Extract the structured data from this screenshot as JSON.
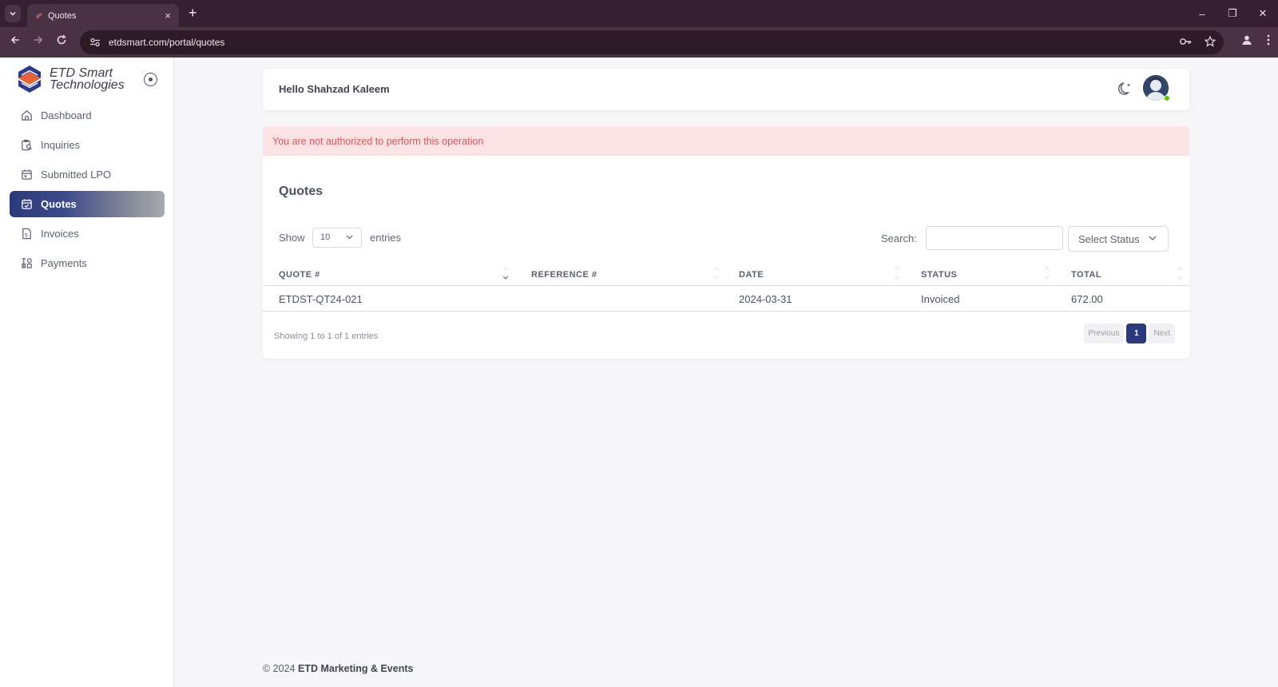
{
  "browser": {
    "tab_title": "Quotes",
    "tab_close": "×",
    "new_tab": "+",
    "url": "etdsmart.com/portal/quotes",
    "window_controls": [
      "–",
      "❐",
      "✕"
    ]
  },
  "brand": {
    "line1": "ETD Smart",
    "line2": "Technologies"
  },
  "sidebar": {
    "items": [
      {
        "label": "Dashboard",
        "icon": "home-icon",
        "active": false
      },
      {
        "label": "Inquiries",
        "icon": "inquiry-icon",
        "active": false
      },
      {
        "label": "Submitted LPO",
        "icon": "calendar-icon",
        "active": false
      },
      {
        "label": "Quotes",
        "icon": "calendar-check-icon",
        "active": true
      },
      {
        "label": "Invoices",
        "icon": "invoice-icon",
        "active": false
      },
      {
        "label": "Payments",
        "icon": "payments-icon",
        "active": false
      }
    ]
  },
  "header": {
    "greeting": "Hello Shahzad Kaleem"
  },
  "alert": {
    "message": "You are not authorized to perform this operation"
  },
  "quotes": {
    "title": "Quotes",
    "show_label": "Show",
    "page_length": "10",
    "entries_label": "entries",
    "search_label": "Search:",
    "search_value": "",
    "status_filter": "Select Status",
    "columns": [
      "QUOTE #",
      "REFERENCE #",
      "DATE",
      "STATUS",
      "TOTAL"
    ],
    "rows": [
      {
        "quote": "ETDST-QT24-021",
        "reference": "",
        "date": "2024-03-31",
        "status": "Invoiced",
        "total": "672.00"
      }
    ],
    "info": "Showing 1 to 1 of 1 entries",
    "pagination": {
      "previous": "Previous",
      "current": "1",
      "next": "Next"
    }
  },
  "footer": {
    "copyright": "© 2024",
    "company": "ETD Marketing & Events"
  },
  "colors": {
    "accent": "#2a3a7a",
    "alert_bg": "#fbe2e4",
    "alert_text": "#d4585c",
    "online": "#56ca00"
  }
}
